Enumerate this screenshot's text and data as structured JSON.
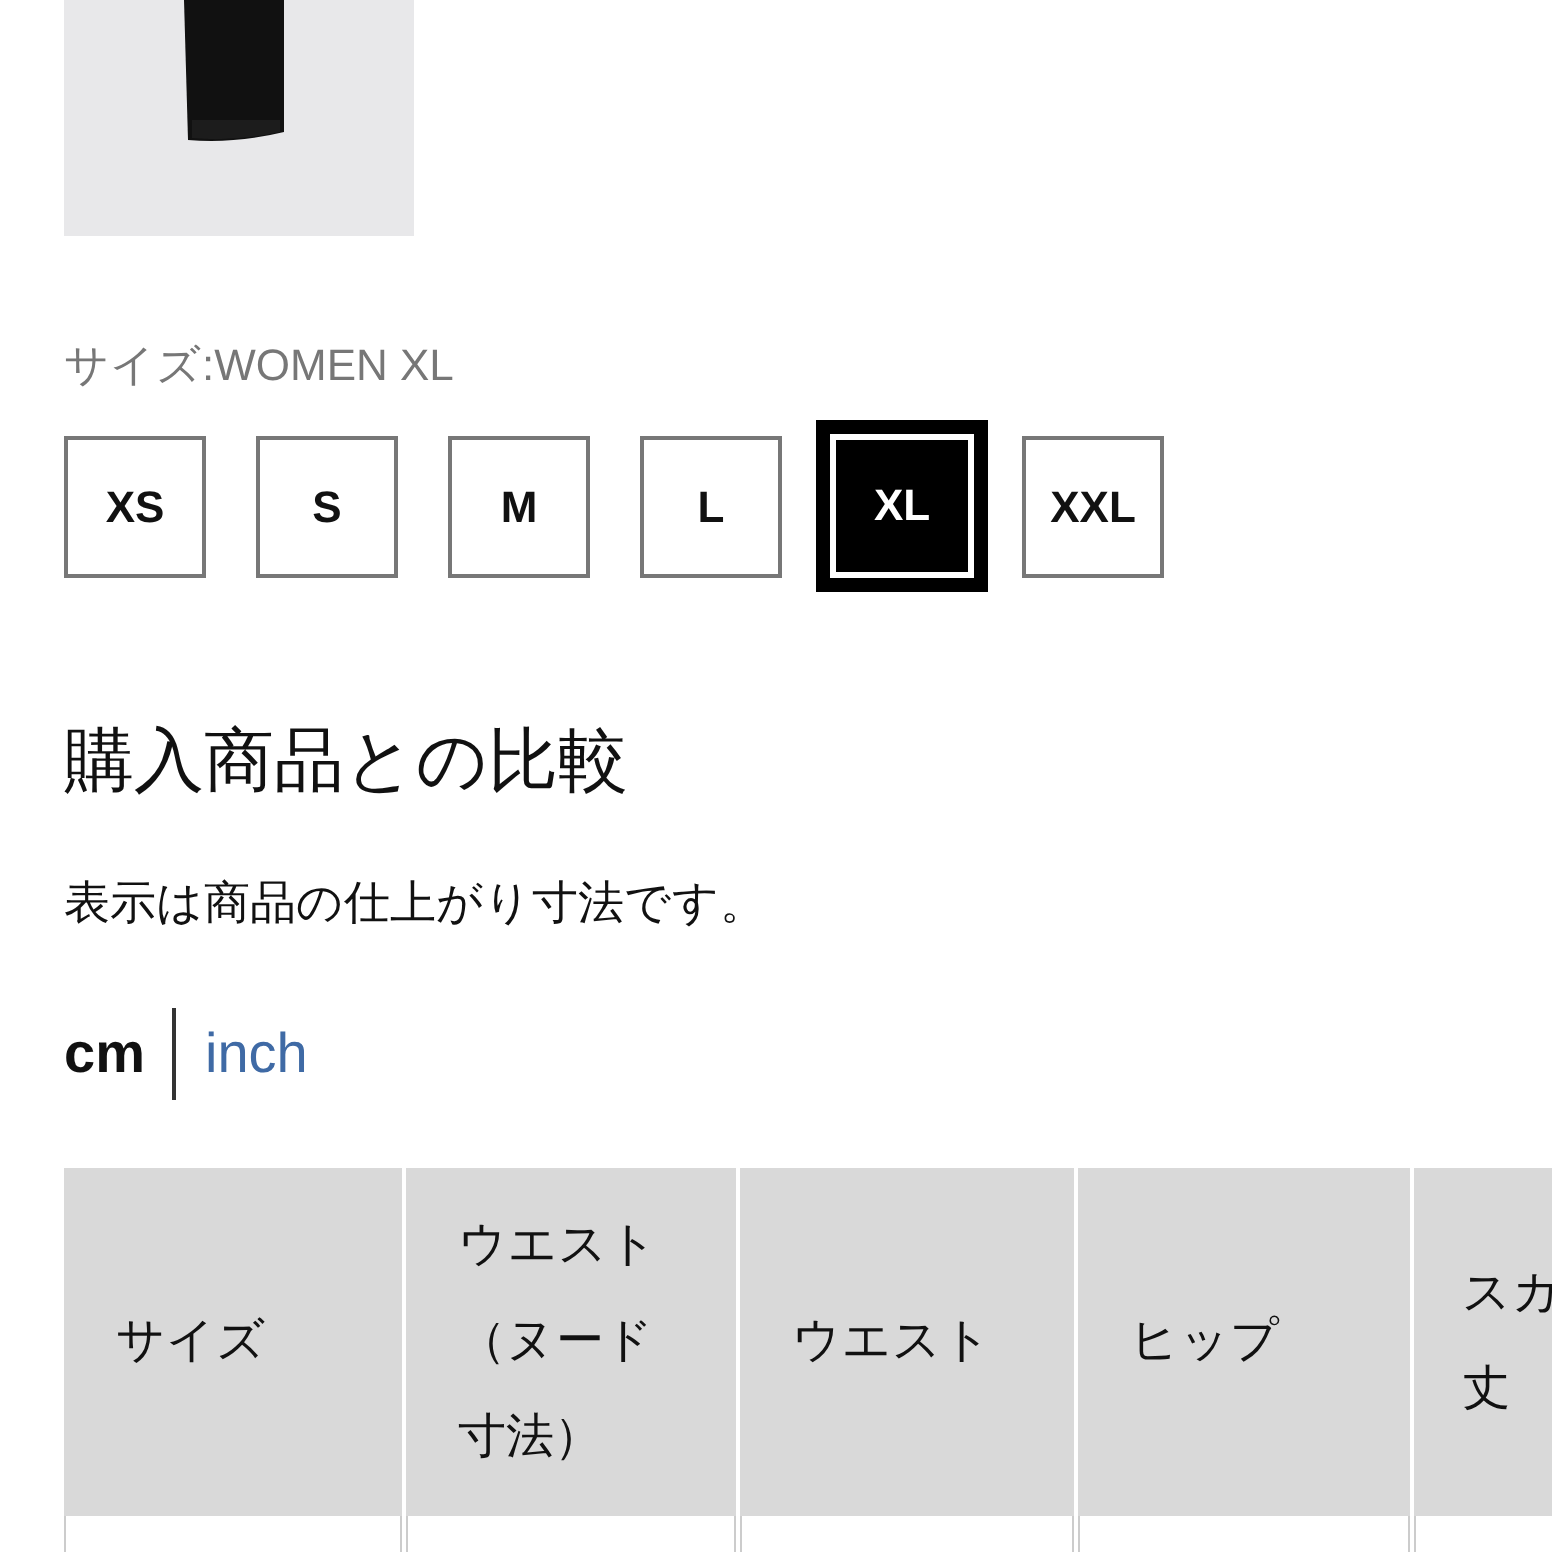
{
  "size_label": "サイズ:WOMEN XL",
  "sizes": [
    {
      "label": "XS",
      "selected": false
    },
    {
      "label": "S",
      "selected": false
    },
    {
      "label": "M",
      "selected": false
    },
    {
      "label": "L",
      "selected": false
    },
    {
      "label": "XL",
      "selected": true
    },
    {
      "label": "XXL",
      "selected": false
    }
  ],
  "heading": "購入商品との比較",
  "note": "表示は商品の仕上がり寸法です。",
  "units": [
    {
      "label": "cm",
      "selected": true
    },
    {
      "label": "inch",
      "selected": false
    }
  ],
  "table": {
    "columns": [
      {
        "lines": [
          "サイズ"
        ]
      },
      {
        "lines": [
          "ウエスト",
          "（ヌード",
          "寸法）"
        ]
      },
      {
        "lines": [
          "ウエスト"
        ]
      },
      {
        "lines": [
          "ヒップ"
        ]
      },
      {
        "lines": [
          "スカ",
          "丈"
        ]
      }
    ]
  }
}
